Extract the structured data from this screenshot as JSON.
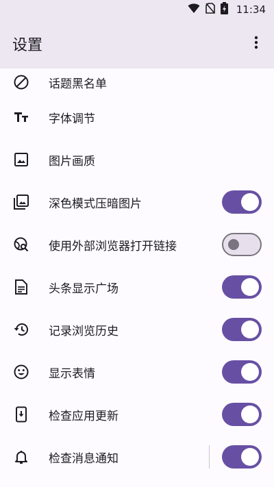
{
  "status_bar": {
    "time": "11:34"
  },
  "app_bar": {
    "title": "设置",
    "more_icon": "more-vert-icon"
  },
  "settings": [
    {
      "icon": "block-icon",
      "label": "话题黑名单",
      "toggle": null
    },
    {
      "icon": "text-size-icon",
      "label": "字体调节",
      "toggle": null
    },
    {
      "icon": "image-icon",
      "label": "图片画质",
      "toggle": null
    },
    {
      "icon": "photo-library-icon",
      "label": "深色模式压暗图片",
      "toggle": true
    },
    {
      "icon": "travel-explore-icon",
      "label": "使用外部浏览器打开链接",
      "toggle": false
    },
    {
      "icon": "article-icon",
      "label": "头条显示广场",
      "toggle": true
    },
    {
      "icon": "history-icon",
      "label": "记录浏览历史",
      "toggle": true
    },
    {
      "icon": "emoji-icon",
      "label": "显示表情",
      "toggle": true
    },
    {
      "icon": "system-update-icon",
      "label": "检查应用更新",
      "toggle": true
    },
    {
      "icon": "notification-bell-icon",
      "label": "检查消息通知",
      "toggle": true
    }
  ],
  "colors": {
    "accent": "#6750a4",
    "app_bar_bg": "#ece7f1",
    "background": "#fdfbff"
  }
}
